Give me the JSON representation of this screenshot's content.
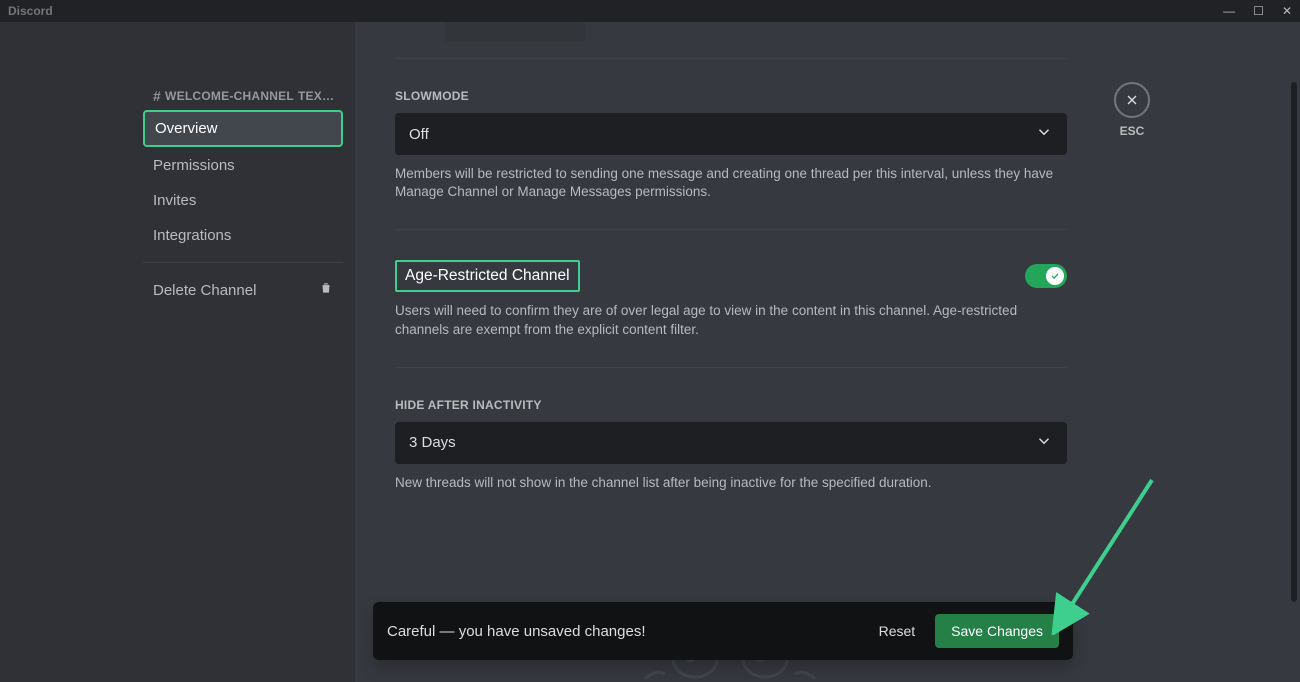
{
  "app_title": "Discord",
  "esc_label": "ESC",
  "sidebar": {
    "channel_name": "WELCOME-CHANNEL",
    "channel_suffix": "TEX…",
    "items": [
      {
        "label": "Overview",
        "selected": true
      },
      {
        "label": "Permissions",
        "selected": false
      },
      {
        "label": "Invites",
        "selected": false
      },
      {
        "label": "Integrations",
        "selected": false
      }
    ],
    "delete_label": "Delete Channel"
  },
  "slowmode": {
    "header": "Slowmode",
    "value": "Off",
    "description": "Members will be restricted to sending one message and creating one thread per this interval, unless they have Manage Channel or Manage Messages permissions."
  },
  "age_restricted": {
    "label": "Age-Restricted Channel",
    "enabled": true,
    "description": "Users will need to confirm they are of over legal age to view in the content in this channel. Age-restricted channels are exempt from the explicit content filter."
  },
  "hide_inactivity": {
    "header": "Hide After Inactivity",
    "value": "3 Days",
    "description": "New threads will not show in the channel list after being inactive for the specified duration."
  },
  "unsaved": {
    "message": "Careful — you have unsaved changes!",
    "reset": "Reset",
    "save": "Save Changes"
  },
  "colors": {
    "highlight": "#3ecf8e",
    "toggle_on": "#23a55a",
    "save_button": "#248046"
  }
}
